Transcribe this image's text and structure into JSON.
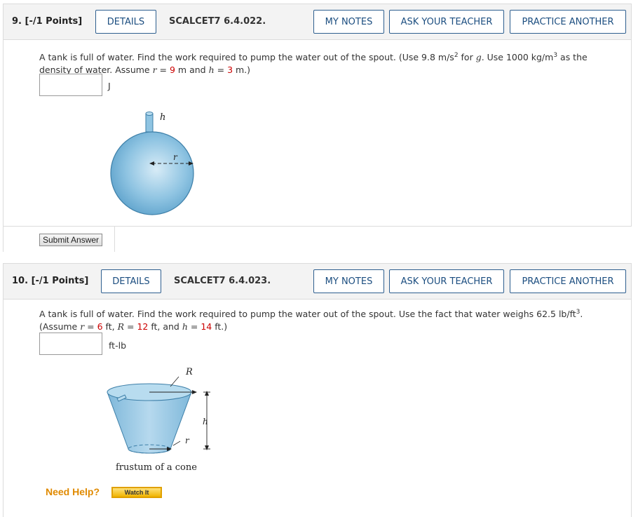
{
  "q9": {
    "number": "9.",
    "points": "[-/1 Points]",
    "details_label": "DETAILS",
    "code": "SCALCET7 6.4.022.",
    "my_notes_label": "MY NOTES",
    "ask_teacher_label": "ASK YOUR TEACHER",
    "practice_label": "PRACTICE ANOTHER",
    "text_1": "A tank is full of water. Find the work required to pump the water out of the spout. (Use 9.8 m/s",
    "sup_1": "2",
    "text_2": " for ",
    "g": "g",
    "text_3": ". Use 1000 kg/m",
    "sup_2": "3",
    "text_4": " as the",
    "text_5": "density of water. Assume ",
    "r": "r",
    "eq": " = ",
    "r_val": "9",
    "text_6": " m and ",
    "h": "h",
    "h_val": "3",
    "text_7": " m.)",
    "answer_value": "",
    "unit": "J",
    "fig_label_h": "h",
    "fig_label_r": "r",
    "submit_label": "Submit Answer"
  },
  "q10": {
    "number": "10.",
    "points": "[-/1 Points]",
    "details_label": "DETAILS",
    "code": "SCALCET7 6.4.023.",
    "my_notes_label": "MY NOTES",
    "ask_teacher_label": "ASK YOUR TEACHER",
    "practice_label": "PRACTICE ANOTHER",
    "text_1": "A tank is full of water. Find the work required to pump the water out of the spout. Use the fact that water weighs 62.5 lb/ft",
    "sup_1": "3",
    "text_2": ".",
    "text_3": "(Assume ",
    "r": "r",
    "eq": " = ",
    "r_val": "6",
    "text_4": " ft, ",
    "R": "R",
    "R_val": "12",
    "text_5": " ft, and ",
    "h": "h",
    "h_val": "14",
    "text_6": " ft.)",
    "answer_value": "",
    "unit": "ft-lb",
    "fig_label_R": "R",
    "fig_label_h": "h",
    "fig_label_r": "r",
    "fig_caption": "frustum of a cone",
    "need_help": "Need Help?",
    "watch_label": "Watch It"
  },
  "colors": {
    "button_border": "#2e5f8f",
    "button_text": "#1c4e80",
    "highlight_red": "#cc0000",
    "need_help": "#e08a00"
  }
}
